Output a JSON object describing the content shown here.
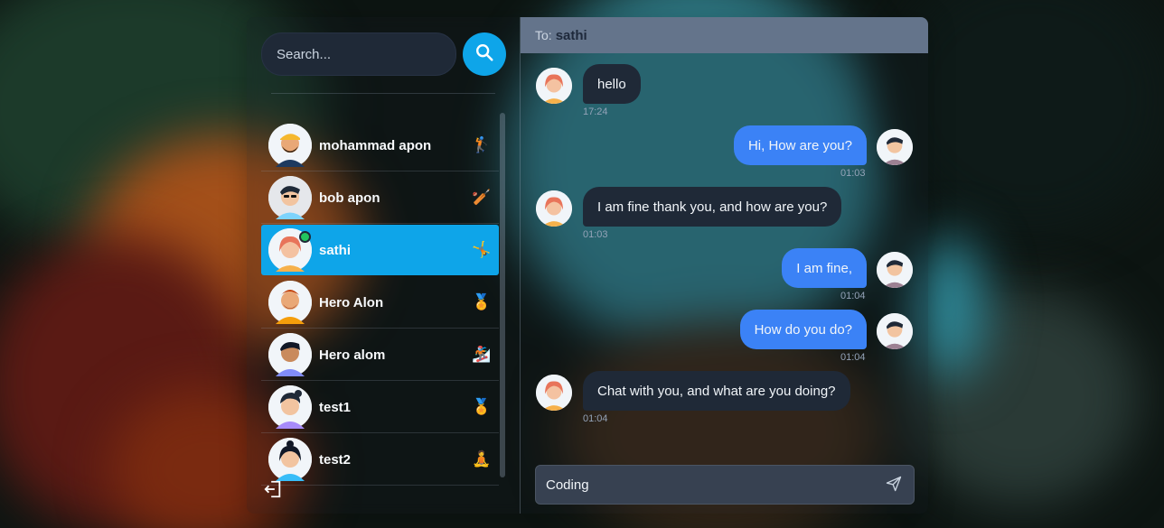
{
  "search": {
    "placeholder": "Search..."
  },
  "conversations": [
    {
      "name": "mohammad apon",
      "emoji": "🏌️",
      "active": false,
      "online": false
    },
    {
      "name": "bob apon",
      "emoji": "🏏",
      "active": false,
      "online": false
    },
    {
      "name": "sathi",
      "emoji": "🤸",
      "active": true,
      "online": true
    },
    {
      "name": "Hero Alon",
      "emoji": "🏅",
      "active": false,
      "online": false
    },
    {
      "name": "Hero alom",
      "emoji": "🏂",
      "active": false,
      "online": false
    },
    {
      "name": "test1",
      "emoji": "🏅",
      "active": false,
      "online": false
    },
    {
      "name": "test2",
      "emoji": "🧘",
      "active": false,
      "online": false
    }
  ],
  "chat": {
    "to_label": "To:",
    "to_name": "sathi",
    "messages": [
      {
        "text": "hello",
        "time": "17:24",
        "direction": "in"
      },
      {
        "text": "Hi, How are you?",
        "time": "01:03",
        "direction": "out"
      },
      {
        "text": "I am fine thank you, and how are you?",
        "time": "01:03",
        "direction": "in"
      },
      {
        "text": "I am fine,",
        "time": "01:04",
        "direction": "out"
      },
      {
        "text": "How do you do?",
        "time": "01:04",
        "direction": "out"
      },
      {
        "text": "Chat with you, and what are you doing?",
        "time": "01:04",
        "direction": "in"
      }
    ],
    "composer_value": "Coding"
  },
  "colors": {
    "accent": "#0ea5e9",
    "outgoing_bubble": "#3b82f6",
    "incoming_bubble": "#1f2937",
    "header": "#64748b"
  },
  "icons": {
    "search": "search-icon",
    "logout": "logout-icon",
    "send": "send-icon"
  }
}
